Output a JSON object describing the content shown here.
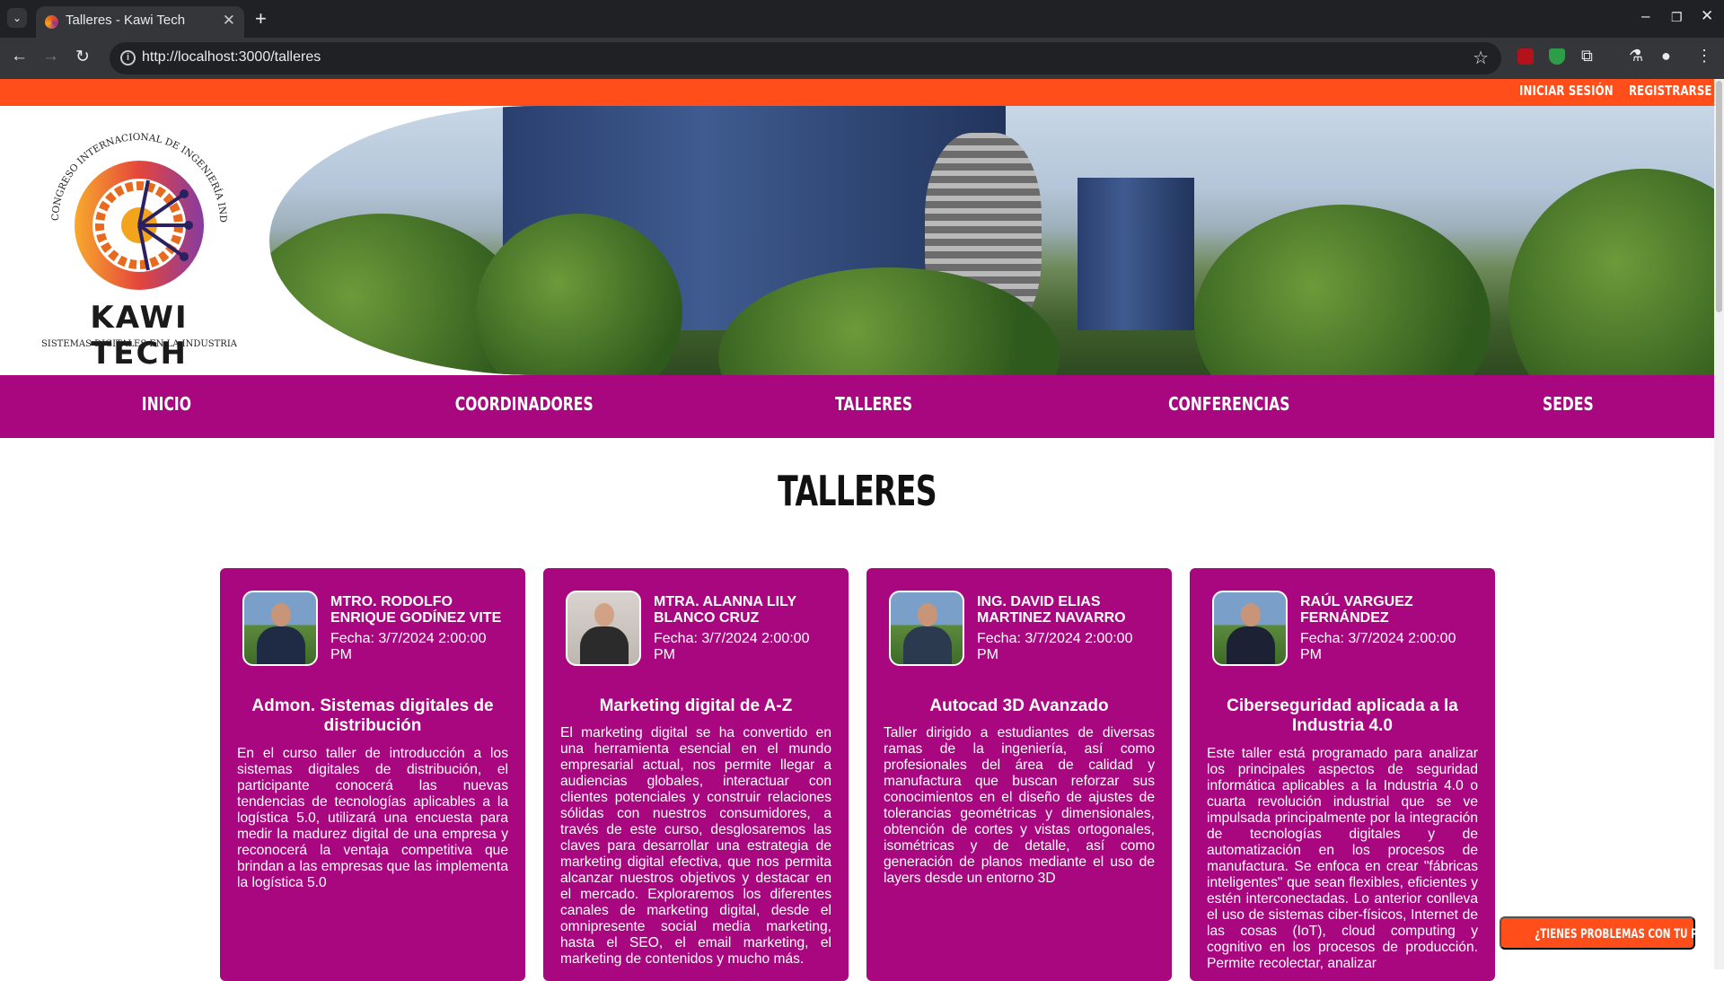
{
  "browser": {
    "tab_title": "Talleres - Kawi Tech",
    "url": "http://localhost:3000/talleres"
  },
  "site": {
    "logo_text": "KAWI TECH",
    "logo_subtitle": "SISTEMAS DIGITALES EN LA INDUSTRIA",
    "logo_arc_text": "CONGRESO INTERNACIONAL DE INGENIERÍA INDUSTRIAL",
    "login": "INICIAR SESIÓN",
    "register": "REGISTRARSE"
  },
  "nav": [
    {
      "label": "INICIO"
    },
    {
      "label": "COORDINADORES"
    },
    {
      "label": "TALLERES"
    },
    {
      "label": "CONFERENCIAS"
    },
    {
      "label": "SEDES"
    }
  ],
  "page_title": "TALLERES",
  "cards": [
    {
      "speaker": "MTRO. RODOLFO ENRIQUE GODÍNEZ VITE",
      "fecha": "Fecha: 3/7/2024 2:00:00 PM",
      "title": "Admon. Sistemas digitales de distribución",
      "description": "En el curso taller de introducción a los sistemas digitales de distribución, el participante conocerá las nuevas tendencias de tecnologías aplicables a la logística 5.0, utilizará una encuesta para medir la madurez digital de una empresa y reconocerá la ventaja competitiva que brindan a las empresas que las implementa la logística 5.0"
    },
    {
      "speaker": "MTRA. ALANNA LILY BLANCO CRUZ",
      "fecha": "Fecha: 3/7/2024 2:00:00 PM",
      "title": "Marketing digital de A-Z",
      "description": "El marketing digital se ha convertido en una herramienta esencial en el mundo empresarial actual, nos permite llegar a audiencias globales, interactuar con clientes potenciales y construir relaciones sólidas con nuestros consumidores, a través de este curso, desglosaremos las claves para desarrollar una estrategia de marketing digital efectiva, que nos permita alcanzar nuestros objetivos y destacar en el mercado. Exploraremos los diferentes canales de marketing digital, desde el omnipresente social media marketing, hasta el SEO, el email marketing, el marketing de contenidos y mucho más."
    },
    {
      "speaker": "ING. DAVID ELIAS MARTINEZ NAVARRO",
      "fecha": "Fecha: 3/7/2024 2:00:00 PM",
      "title": "Autocad 3D Avanzado",
      "description": "Taller dirigido a estudiantes de diversas ramas de la ingeniería, así como profesionales del área de calidad y manufactura que buscan reforzar sus conocimientos en el diseño de ajustes de tolerancias geométricas y dimensionales, obtención de cortes y vistas ortogonales, isométricas y de detalle, así como generación de planos mediante el uso de layers desde un entorno 3D"
    },
    {
      "speaker": "RAÚL VARGUEZ FERNÁNDEZ",
      "fecha": "Fecha: 3/7/2024 2:00:00 PM",
      "title": "Ciberseguridad aplicada a la Industria 4.0",
      "description": "Este taller está programado para analizar los principales aspectos de seguridad informática aplicables a la Industria 4.0 o cuarta revolución industrial que se ve impulsada principalmente por la integración de tecnologías digitales y de automatización en los procesos de manufactura. Se enfoca en crear \"fábricas inteligentes\" que sean flexibles, eficientes y estén interconectadas. Lo anterior conlleva el uso de sistemas ciber-físicos, Internet de las cosas (IoT), cloud computing y cognitivo en los procesos de producción. Permite recolectar, analizar"
    }
  ],
  "payment_button": "¿TIENES PROBLEMAS CON TU PAGO?",
  "colors": {
    "accent_orange": "#ff4e1a",
    "accent_magenta": "#a8077f"
  }
}
